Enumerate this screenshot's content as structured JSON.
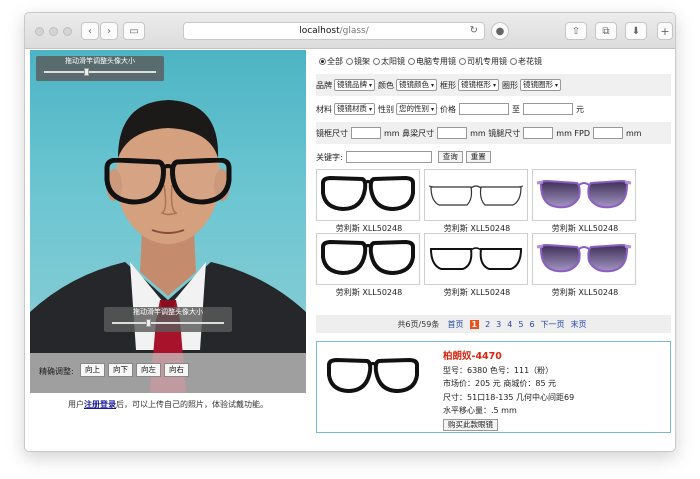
{
  "browser": {
    "url_host": "localhost",
    "url_path": "/glass/"
  },
  "photo": {
    "top_slider_label": "拖动滑竿调整头像大小",
    "bottom_slider_label": "拖动滑竿调整头像大小",
    "adjust_label": "精确调整:",
    "adjust_buttons": [
      "向上",
      "向下",
      "向左",
      "向右"
    ]
  },
  "notice": {
    "prefix": "用户",
    "link": "注册登录",
    "suffix": "后，可以上传自己的照片，体验试戴功能。"
  },
  "filters": {
    "categories": [
      "全部",
      "镜架",
      "太阳镜",
      "电脑专用镜",
      "司机专用镜",
      "老花镜"
    ],
    "selected_category": "全部",
    "brand_label": "品牌",
    "brand_value": "镜镜品牌",
    "color_label": "颜色",
    "color_value": "镜镜颜色",
    "frame_label": "框形",
    "frame_value": "镜镜框形",
    "shape_label": "圈形",
    "shape_value": "镜镜圈形",
    "material_label": "材料",
    "material_value": "镜镜材质",
    "gender_label": "性别",
    "gender_value": "您的性别",
    "price_label": "价格",
    "price_to": "至",
    "price_unit": "元",
    "frame_size_label": "镜框尺寸",
    "bridge_label": "鼻梁尺寸",
    "temple_label": "镜腿尺寸",
    "fpd_label": "FPD",
    "unit_mm": "mm",
    "keyword_label": "关键字:",
    "search_button": "查询",
    "reset_button": "重置"
  },
  "products": [
    {
      "name": "劳利斯 XLL50248",
      "style": "black-thick"
    },
    {
      "name": "劳利斯 XLL50248",
      "style": "thin-rimless"
    },
    {
      "name": "劳利斯 XLL50248",
      "style": "purple-sun"
    },
    {
      "name": "劳利斯 XLL50248",
      "style": "black-thick"
    },
    {
      "name": "劳利斯 XLL50248",
      "style": "thin-black"
    },
    {
      "name": "劳利斯 XLL50248",
      "style": "purple-sun"
    }
  ],
  "pager": {
    "summary": "共6页/59条",
    "first": "首页",
    "current": "1",
    "pages": [
      "2",
      "3",
      "4",
      "5",
      "6"
    ],
    "next": "下一页",
    "last": "末页"
  },
  "detail": {
    "title": "柏朗奴-4470",
    "model_line": "型号：6380 色号：111（粉）",
    "price_line": "市场价：205 元 商城价：85 元",
    "size_line": "尺寸：51口18-135 几何中心间距69",
    "shift_line": "水平移心量：.5 mm",
    "buy_button": "购买此款眼镜"
  },
  "colors": {
    "accent_red": "#d8240f",
    "page_current": "#e8521a",
    "link_blue": "#224aa8",
    "detail_border": "#78b9d5"
  }
}
